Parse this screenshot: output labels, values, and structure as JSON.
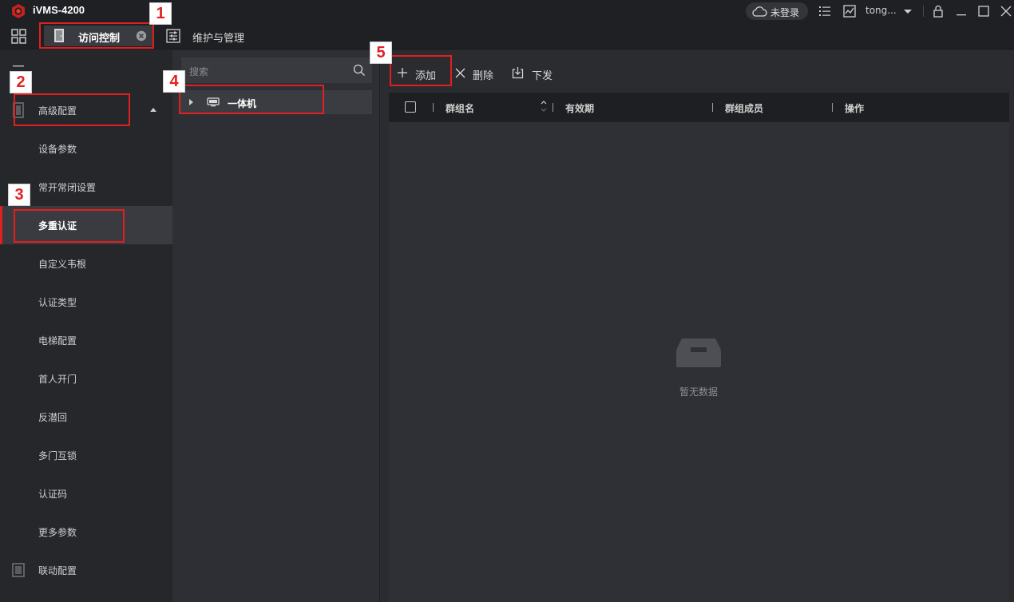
{
  "app": {
    "title": "iVMS-4200"
  },
  "titlebar": {
    "cloud_status": "未登录",
    "user": "tong..."
  },
  "tabs": [
    {
      "label": "访问控制"
    },
    {
      "label": "维护与管理"
    }
  ],
  "sidebar": {
    "items": [
      {
        "label": "高级配置",
        "type": "group"
      },
      {
        "label": "设备参数"
      },
      {
        "label": "常开常闭设置"
      },
      {
        "label": "多重认证",
        "active": true
      },
      {
        "label": "自定义韦根"
      },
      {
        "label": "认证类型"
      },
      {
        "label": "电梯配置"
      },
      {
        "label": "首人开门"
      },
      {
        "label": "反潜回"
      },
      {
        "label": "多门互锁"
      },
      {
        "label": "认证码"
      },
      {
        "label": "更多参数"
      },
      {
        "label": "联动配置",
        "type": "group"
      }
    ]
  },
  "tree": {
    "search_placeholder": "搜索",
    "node": "一体机"
  },
  "toolbar": {
    "add": "添加",
    "delete": "删除",
    "issue": "下发"
  },
  "table": {
    "columns": [
      "群组名",
      "有效期",
      "群组成员",
      "操作"
    ],
    "empty_text": "暂无数据"
  },
  "annotations": [
    "1",
    "2",
    "3",
    "4",
    "5"
  ],
  "colors": {
    "accent": "#e0211f",
    "bg": "#2b2c30",
    "sidebar": "#26272b"
  }
}
